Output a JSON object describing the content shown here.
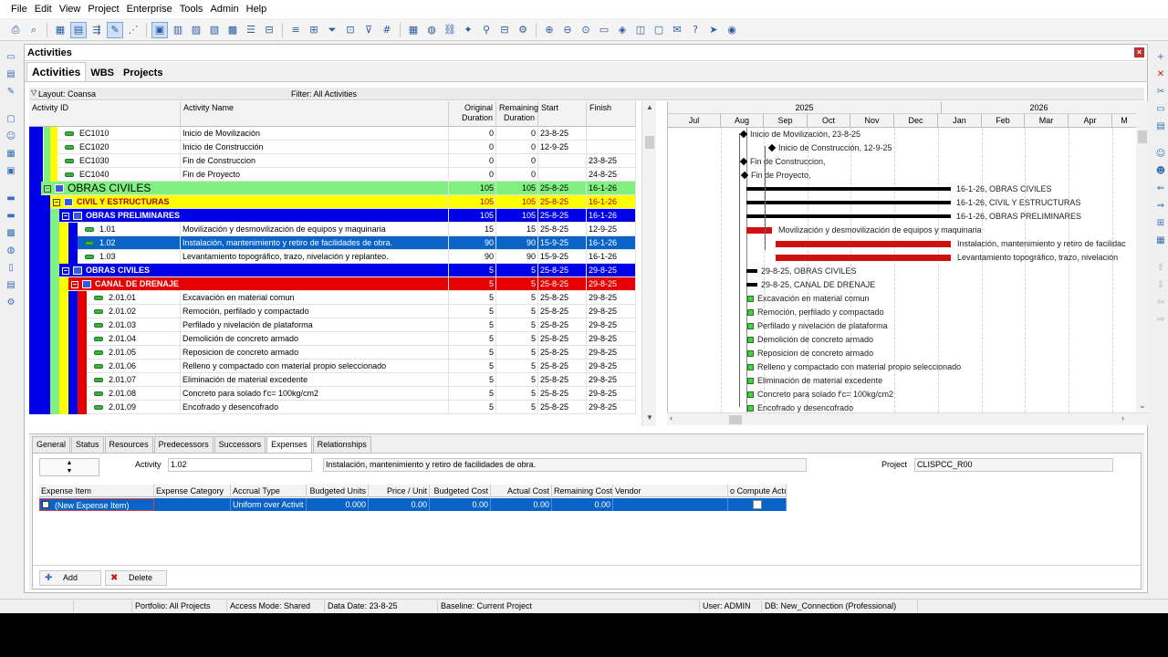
{
  "menu": [
    "File",
    "Edit",
    "View",
    "Project",
    "Enterprise",
    "Tools",
    "Admin",
    "Help"
  ],
  "panel": {
    "title": "Activities",
    "tabs": [
      "Activities",
      "WBS",
      "Projects"
    ],
    "layout": "Layout: Coansa",
    "filter": "Filter: All Activities"
  },
  "grid": {
    "headers": {
      "id": "Activity ID",
      "name": "Activity Name",
      "orig": "Original Duration",
      "rem": "Remaining Duration",
      "start": "Start",
      "finish": "Finish"
    },
    "rows": [
      {
        "type": "act",
        "id": "EC1010",
        "name": "Inicio de Movilización",
        "orig": "0",
        "rem": "0",
        "start": "23-8-25",
        "finish": ""
      },
      {
        "type": "act",
        "id": "EC1020",
        "name": "Inicio de Construcción",
        "orig": "0",
        "rem": "0",
        "start": "12-9-25",
        "finish": ""
      },
      {
        "type": "act",
        "id": "EC1030",
        "name": "Fin de Construccion",
        "orig": "0",
        "rem": "0",
        "start": "",
        "finish": "23-8-25"
      },
      {
        "type": "act",
        "id": "EC1040",
        "name": "Fin de Proyecto",
        "orig": "0",
        "rem": "0",
        "start": "",
        "finish": "24-8-25"
      },
      {
        "type": "wbs1",
        "id": "OBRAS CIVILES",
        "name": "",
        "orig": "105",
        "rem": "105",
        "start": "25-8-25",
        "finish": "16-1-26"
      },
      {
        "type": "wbs2",
        "id": "CIVIL Y ESTRUCTURAS",
        "name": "",
        "orig": "105",
        "rem": "105",
        "start": "25-8-25",
        "finish": "16-1-26"
      },
      {
        "type": "wbs3",
        "id": "OBRAS PRELIMINARES",
        "name": "",
        "orig": "105",
        "rem": "105",
        "start": "25-8-25",
        "finish": "16-1-26"
      },
      {
        "type": "act3",
        "id": "1.01",
        "name": "Movilización y desmovilización de equipos y maquinaria",
        "orig": "15",
        "rem": "15",
        "start": "25-8-25",
        "finish": "12-9-25"
      },
      {
        "type": "sel",
        "id": "1.02",
        "name": "Instalación, mantenimiento y retiro de facilidades de obra.",
        "orig": "90",
        "rem": "90",
        "start": "15-9-25",
        "finish": "16-1-26"
      },
      {
        "type": "act3",
        "id": "1.03",
        "name": "Levantamiento topográfico, trazo, nivelación y replanteo.",
        "orig": "90",
        "rem": "90",
        "start": "15-9-25",
        "finish": "16-1-26"
      },
      {
        "type": "wbs3",
        "id": "OBRAS CIVILES",
        "name": "",
        "orig": "5",
        "rem": "5",
        "start": "25-8-25",
        "finish": "29-8-25"
      },
      {
        "type": "wbs4",
        "id": "CANAL DE DRENAJE",
        "name": "",
        "orig": "5",
        "rem": "5",
        "start": "25-8-25",
        "finish": "29-8-25"
      },
      {
        "type": "act4",
        "id": "2.01.01",
        "name": "Excavación en material comun",
        "orig": "5",
        "rem": "5",
        "start": "25-8-25",
        "finish": "29-8-25"
      },
      {
        "type": "act4",
        "id": "2.01.02",
        "name": "Remoción, perfilado y compactado",
        "orig": "5",
        "rem": "5",
        "start": "25-8-25",
        "finish": "29-8-25"
      },
      {
        "type": "act4",
        "id": "2.01.03",
        "name": "Perfilado y nivelación de plataforma",
        "orig": "5",
        "rem": "5",
        "start": "25-8-25",
        "finish": "29-8-25"
      },
      {
        "type": "act4",
        "id": "2.01.04",
        "name": "Demolición de concreto armado",
        "orig": "5",
        "rem": "5",
        "start": "25-8-25",
        "finish": "29-8-25"
      },
      {
        "type": "act4",
        "id": "2.01.05",
        "name": "Reposicion de concreto armado",
        "orig": "5",
        "rem": "5",
        "start": "25-8-25",
        "finish": "29-8-25"
      },
      {
        "type": "act4",
        "id": "2.01.06",
        "name": "Relleno y compactado con material propio seleccionado",
        "orig": "5",
        "rem": "5",
        "start": "25-8-25",
        "finish": "29-8-25"
      },
      {
        "type": "act4",
        "id": "2.01.07",
        "name": "Eliminación de material excedente",
        "orig": "5",
        "rem": "5",
        "start": "25-8-25",
        "finish": "29-8-25"
      },
      {
        "type": "act4",
        "id": "2.01.08",
        "name": "Concreto para solado f'c= 100kg/cm2",
        "orig": "5",
        "rem": "5",
        "start": "25-8-25",
        "finish": "29-8-25"
      },
      {
        "type": "act4",
        "id": "2.01.09",
        "name": "Encofrado y desencofrado",
        "orig": "5",
        "rem": "5",
        "start": "25-8-25",
        "finish": "29-8-25"
      }
    ]
  },
  "gantt": {
    "years": [
      "2025",
      "2026"
    ],
    "months": [
      "Jul",
      "Aug",
      "Sep",
      "Oct",
      "Nov",
      "Dec",
      "Jan",
      "Feb",
      "Mar",
      "Apr",
      "M"
    ],
    "labels": [
      "Inicio de Movilización, 23-8-25",
      "Inicio de Construcción, 12-9-25",
      "Fin de Construccion,",
      "Fin de Proyecto,",
      "16-1-26, OBRAS CIVILES",
      "16-1-26, CIVIL Y ESTRUCTURAS",
      "16-1-26, OBRAS PRELIMINARES",
      "Movilización y desmovilización de equipos y maquinaria",
      "Instalación, mantenimiento y retiro de facilidac",
      "Levantamiento topográfico, trazo, nivelación",
      "29-8-25, OBRAS CIVILES",
      "29-8-25, CANAL DE DRENAJE",
      "Excavación en material comun",
      "Remoción, perfilado y compactado",
      "Perfilado y nivelación de plataforma",
      "Demolición de concreto armado",
      "Reposicion de concreto armado",
      "Relleno y compactado con material propio seleccionado",
      "Eliminación de material excedente",
      "Concreto para solado f'c= 100kg/cm2",
      "Encofrado y desencofrado"
    ]
  },
  "detail": {
    "tabs": [
      "General",
      "Status",
      "Resources",
      "Predecessors",
      "Successors",
      "Expenses",
      "Relationships"
    ],
    "active_tab": "Expenses",
    "activity_label": "Activity",
    "activity_id": "1.02",
    "activity_name": "Instalación, mantenimiento y retiro de facilidades de obra.",
    "project_label": "Project",
    "project_id": "CLISPCC_R00",
    "exp_headers": [
      "Expense Item",
      "Expense Category",
      "Accrual Type",
      "Budgeted Units",
      "Price / Unit",
      "Budgeted Cost",
      "Actual Cost",
      "Remaining Cost",
      "Vendor",
      "o Compute Actı"
    ],
    "exp_row": [
      "(New Expense Item)",
      "",
      "Uniform over Activit",
      "0.000",
      "0.00",
      "0.00",
      "0.00",
      "0.00",
      "",
      ""
    ],
    "add_label": "Add",
    "delete_label": "Delete"
  },
  "status": {
    "portfolio": "Portfolio: All Projects",
    "access": "Access Mode: Shared",
    "data_date": "Data Date: 23-8-25",
    "baseline": "Baseline: Current Project",
    "user": "User: ADMIN",
    "db": "DB: New_Connection (Professional)"
  },
  "colors": {
    "wbs1": "#80f080",
    "wbs2": "#ffff00",
    "wbs3": "#0000e6",
    "wbs4": "#e60000",
    "selected": "#0a64c8",
    "bar_critical": "#d01010"
  }
}
